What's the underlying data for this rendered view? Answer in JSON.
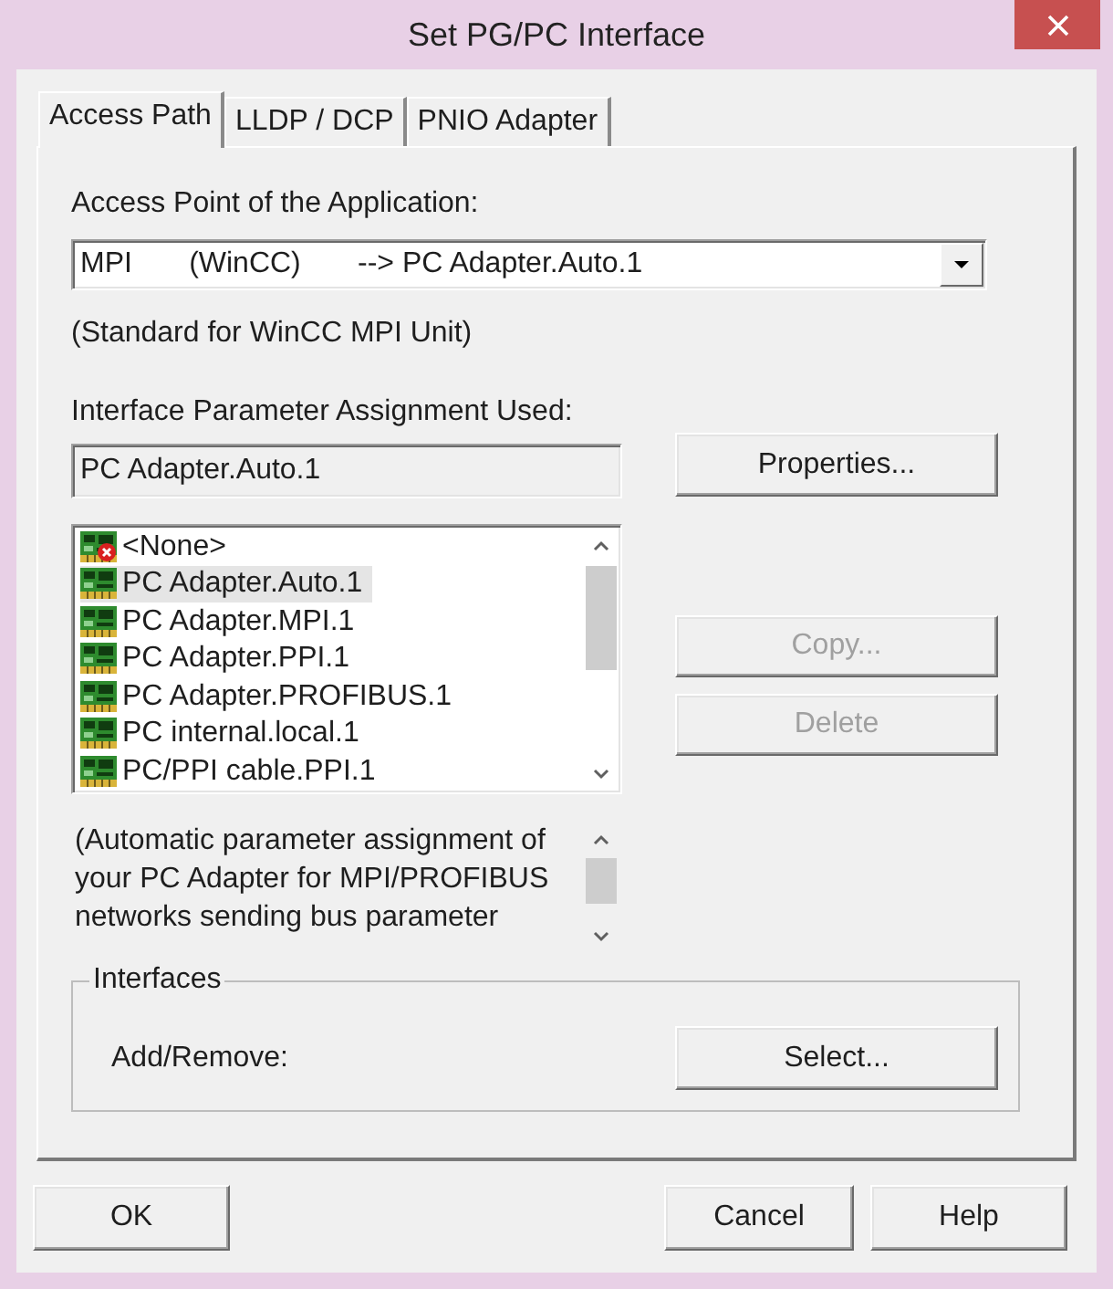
{
  "window": {
    "title": "Set PG/PC Interface"
  },
  "tabs": [
    {
      "label": "Access Path",
      "selected": true
    },
    {
      "label": "LLDP / DCP",
      "selected": false
    },
    {
      "label": "PNIO Adapter",
      "selected": false
    }
  ],
  "access_point": {
    "label": "Access Point of the Application:",
    "value": "MPI       (WinCC)       --> PC Adapter.Auto.1",
    "note": "(Standard for WinCC MPI Unit)"
  },
  "parameter_assignment": {
    "label": "Interface Parameter Assignment Used:",
    "value": "PC Adapter.Auto.1",
    "items": [
      {
        "label": "<None>",
        "kind": "none",
        "selected": false
      },
      {
        "label": "PC Adapter.Auto.1",
        "kind": "adapter",
        "selected": true
      },
      {
        "label": "PC Adapter.MPI.1",
        "kind": "adapter",
        "selected": false
      },
      {
        "label": "PC Adapter.PPI.1",
        "kind": "adapter",
        "selected": false
      },
      {
        "label": "PC Adapter.PROFIBUS.1",
        "kind": "adapter",
        "selected": false
      },
      {
        "label": "PC internal.local.1",
        "kind": "adapter",
        "selected": false
      },
      {
        "label": "PC/PPI cable.PPI.1",
        "kind": "adapter",
        "selected": false
      }
    ],
    "description": "(Automatic parameter assignment of your PC Adapter for MPI/PROFIBUS networks sending bus parameter",
    "buttons": [
      {
        "label": "Properties...",
        "disabled": false
      },
      {
        "label": "Copy...",
        "disabled": true
      },
      {
        "label": "Delete",
        "disabled": true
      }
    ]
  },
  "interfaces": {
    "title": "Interfaces",
    "label": "Add/Remove:",
    "button": "Select..."
  },
  "buttons": [
    "OK",
    "Cancel",
    "Help"
  ]
}
